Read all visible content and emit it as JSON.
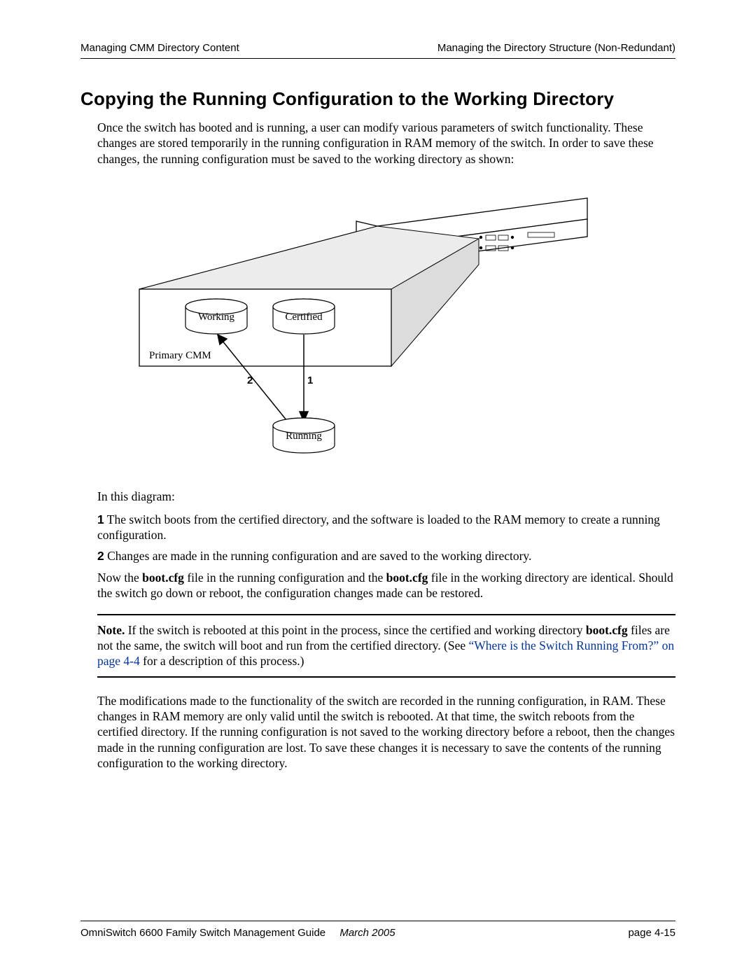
{
  "header": {
    "left": "Managing CMM Directory Content",
    "right": "Managing the Directory Structure (Non-Redundant)"
  },
  "title": "Copying the Running Configuration to the Working Directory",
  "intro": "Once the switch has booted and is running, a user can modify various parameters of switch functionality. These changes are stored temporarily in the running configuration in RAM memory of the switch. In order to save these changes, the running configuration must be saved to the working directory as shown:",
  "diagram": {
    "working": "Working",
    "certified": "Certified",
    "primary_cmm": "Primary CMM",
    "running": "Running",
    "arrow1": "1",
    "arrow2": "2"
  },
  "in_this_diagram": "In this diagram:",
  "step1_num": "1",
  "step1_text": "  The switch boots from the certified directory, and the software is loaded to the RAM memory to create a running configuration.",
  "step2_num": "2",
  "step2_text": "  Changes are made in the running configuration and are saved to the working directory.",
  "now_pre": "Now the ",
  "bootcfg": "boot.cfg",
  "now_mid": " file in the running configuration and the ",
  "now_post": " file in the working directory are identical. Should the switch go down or reboot, the configuration changes made can be restored.",
  "note_label": "Note.",
  "note_body1": " If the switch is rebooted at this point in the process, since the certified and working directory ",
  "note_body2": " files are not the same, the switch will boot and run from the certified directory. (See ",
  "note_link": "“Where is the Switch Running From?” on page 4-4",
  "note_body3": " for a description of this process.)",
  "closing": "The modifications made to the functionality of the switch are recorded in the running configuration, in RAM. These changes in RAM memory are only valid until the switch is rebooted. At that time, the switch reboots from the certified directory. If the running configuration is not saved to the working directory before a reboot, then the changes made in the running configuration are lost. To save these changes it is necessary to save the contents of the running configuration to the working directory.",
  "footer": {
    "guide": "OmniSwitch 6600 Family Switch Management Guide",
    "date": "March 2005",
    "page": "page 4-15"
  }
}
